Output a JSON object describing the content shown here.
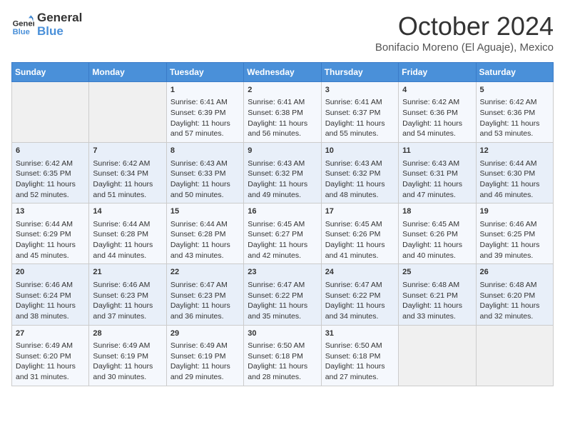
{
  "logo": {
    "line1": "General",
    "line2": "Blue"
  },
  "title": "October 2024",
  "subtitle": "Bonifacio Moreno (El Aguaje), Mexico",
  "headers": [
    "Sunday",
    "Monday",
    "Tuesday",
    "Wednesday",
    "Thursday",
    "Friday",
    "Saturday"
  ],
  "weeks": [
    [
      {
        "day": "",
        "info": ""
      },
      {
        "day": "",
        "info": ""
      },
      {
        "day": "1",
        "info": "Sunrise: 6:41 AM\nSunset: 6:39 PM\nDaylight: 11 hours and 57 minutes."
      },
      {
        "day": "2",
        "info": "Sunrise: 6:41 AM\nSunset: 6:38 PM\nDaylight: 11 hours and 56 minutes."
      },
      {
        "day": "3",
        "info": "Sunrise: 6:41 AM\nSunset: 6:37 PM\nDaylight: 11 hours and 55 minutes."
      },
      {
        "day": "4",
        "info": "Sunrise: 6:42 AM\nSunset: 6:36 PM\nDaylight: 11 hours and 54 minutes."
      },
      {
        "day": "5",
        "info": "Sunrise: 6:42 AM\nSunset: 6:36 PM\nDaylight: 11 hours and 53 minutes."
      }
    ],
    [
      {
        "day": "6",
        "info": "Sunrise: 6:42 AM\nSunset: 6:35 PM\nDaylight: 11 hours and 52 minutes."
      },
      {
        "day": "7",
        "info": "Sunrise: 6:42 AM\nSunset: 6:34 PM\nDaylight: 11 hours and 51 minutes."
      },
      {
        "day": "8",
        "info": "Sunrise: 6:43 AM\nSunset: 6:33 PM\nDaylight: 11 hours and 50 minutes."
      },
      {
        "day": "9",
        "info": "Sunrise: 6:43 AM\nSunset: 6:32 PM\nDaylight: 11 hours and 49 minutes."
      },
      {
        "day": "10",
        "info": "Sunrise: 6:43 AM\nSunset: 6:32 PM\nDaylight: 11 hours and 48 minutes."
      },
      {
        "day": "11",
        "info": "Sunrise: 6:43 AM\nSunset: 6:31 PM\nDaylight: 11 hours and 47 minutes."
      },
      {
        "day": "12",
        "info": "Sunrise: 6:44 AM\nSunset: 6:30 PM\nDaylight: 11 hours and 46 minutes."
      }
    ],
    [
      {
        "day": "13",
        "info": "Sunrise: 6:44 AM\nSunset: 6:29 PM\nDaylight: 11 hours and 45 minutes."
      },
      {
        "day": "14",
        "info": "Sunrise: 6:44 AM\nSunset: 6:28 PM\nDaylight: 11 hours and 44 minutes."
      },
      {
        "day": "15",
        "info": "Sunrise: 6:44 AM\nSunset: 6:28 PM\nDaylight: 11 hours and 43 minutes."
      },
      {
        "day": "16",
        "info": "Sunrise: 6:45 AM\nSunset: 6:27 PM\nDaylight: 11 hours and 42 minutes."
      },
      {
        "day": "17",
        "info": "Sunrise: 6:45 AM\nSunset: 6:26 PM\nDaylight: 11 hours and 41 minutes."
      },
      {
        "day": "18",
        "info": "Sunrise: 6:45 AM\nSunset: 6:26 PM\nDaylight: 11 hours and 40 minutes."
      },
      {
        "day": "19",
        "info": "Sunrise: 6:46 AM\nSunset: 6:25 PM\nDaylight: 11 hours and 39 minutes."
      }
    ],
    [
      {
        "day": "20",
        "info": "Sunrise: 6:46 AM\nSunset: 6:24 PM\nDaylight: 11 hours and 38 minutes."
      },
      {
        "day": "21",
        "info": "Sunrise: 6:46 AM\nSunset: 6:23 PM\nDaylight: 11 hours and 37 minutes."
      },
      {
        "day": "22",
        "info": "Sunrise: 6:47 AM\nSunset: 6:23 PM\nDaylight: 11 hours and 36 minutes."
      },
      {
        "day": "23",
        "info": "Sunrise: 6:47 AM\nSunset: 6:22 PM\nDaylight: 11 hours and 35 minutes."
      },
      {
        "day": "24",
        "info": "Sunrise: 6:47 AM\nSunset: 6:22 PM\nDaylight: 11 hours and 34 minutes."
      },
      {
        "day": "25",
        "info": "Sunrise: 6:48 AM\nSunset: 6:21 PM\nDaylight: 11 hours and 33 minutes."
      },
      {
        "day": "26",
        "info": "Sunrise: 6:48 AM\nSunset: 6:20 PM\nDaylight: 11 hours and 32 minutes."
      }
    ],
    [
      {
        "day": "27",
        "info": "Sunrise: 6:49 AM\nSunset: 6:20 PM\nDaylight: 11 hours and 31 minutes."
      },
      {
        "day": "28",
        "info": "Sunrise: 6:49 AM\nSunset: 6:19 PM\nDaylight: 11 hours and 30 minutes."
      },
      {
        "day": "29",
        "info": "Sunrise: 6:49 AM\nSunset: 6:19 PM\nDaylight: 11 hours and 29 minutes."
      },
      {
        "day": "30",
        "info": "Sunrise: 6:50 AM\nSunset: 6:18 PM\nDaylight: 11 hours and 28 minutes."
      },
      {
        "day": "31",
        "info": "Sunrise: 6:50 AM\nSunset: 6:18 PM\nDaylight: 11 hours and 27 minutes."
      },
      {
        "day": "",
        "info": ""
      },
      {
        "day": "",
        "info": ""
      }
    ]
  ]
}
